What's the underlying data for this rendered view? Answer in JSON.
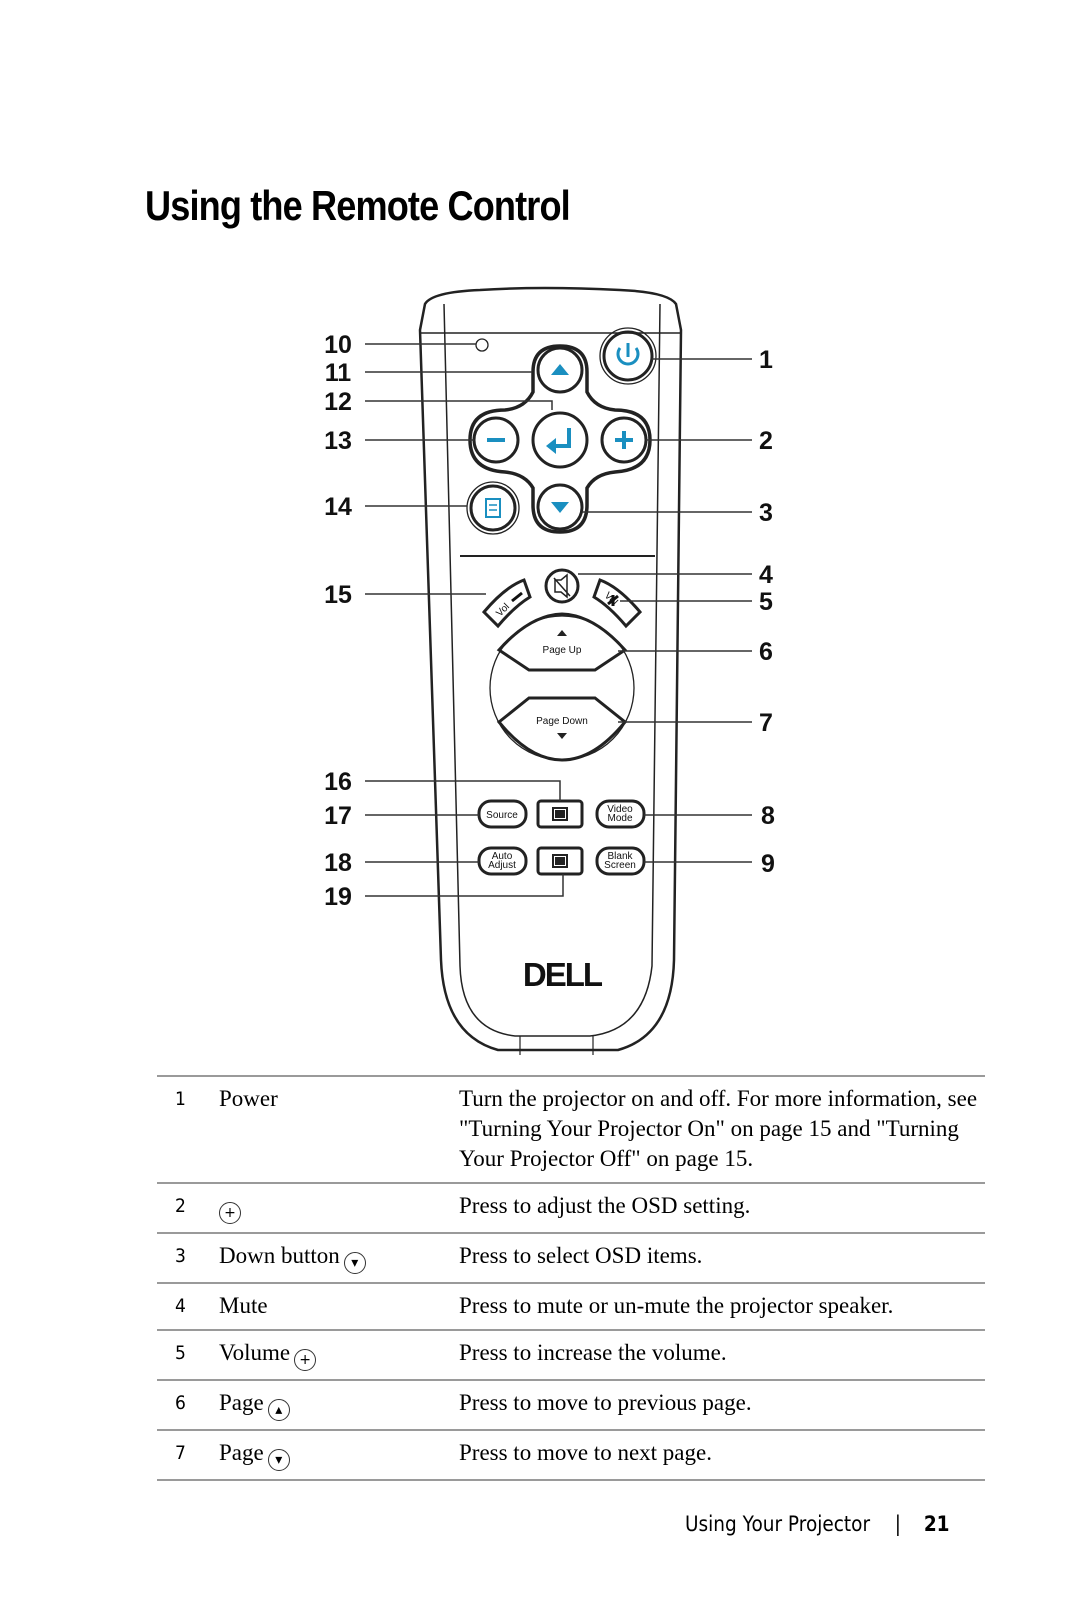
{
  "page": {
    "title": "Using the Remote Control",
    "footer": {
      "section": "Using Your Projector",
      "separator": "|",
      "page_number": "21"
    }
  },
  "remote": {
    "brand_logo": "DELL",
    "callouts": [
      "1",
      "2",
      "3",
      "4",
      "5",
      "6",
      "7",
      "8",
      "9",
      "10",
      "11",
      "12",
      "13",
      "14",
      "15",
      "16",
      "17",
      "18",
      "19"
    ],
    "buttons": {
      "vol_minus": "Vol",
      "vol_plus": "Vol",
      "page_up": "Page Up",
      "page_down": "Page Down",
      "source": "Source",
      "video_mode_line1": "Video",
      "video_mode_line2": "Mode",
      "auto_adjust_line1": "Auto",
      "auto_adjust_line2": "Adjust",
      "blank_screen_line1": "Blank",
      "blank_screen_line2": "Screen"
    },
    "accent_color": "#1a8fc0"
  },
  "legend": {
    "rows": [
      {
        "num": "1",
        "name": "Power",
        "icon": "",
        "desc": "Turn the projector on and off. For more information, see \"Turning Your Projector On\" on page 15 and \"Turning Your Projector Off\" on page 15."
      },
      {
        "num": "2",
        "name": "",
        "icon": "+",
        "desc": "Press to adjust the OSD setting."
      },
      {
        "num": "3",
        "name": "Down button",
        "icon": "▾",
        "desc": "Press to select OSD items."
      },
      {
        "num": "4",
        "name": "Mute",
        "icon": "",
        "desc": "Press to mute or un-mute the projector speaker."
      },
      {
        "num": "5",
        "name": "Volume",
        "icon": "+",
        "desc": "Press to increase the volume."
      },
      {
        "num": "6",
        "name": "Page",
        "icon": "▴",
        "desc": "Press to move to previous page."
      },
      {
        "num": "7",
        "name": "Page",
        "icon": "▾",
        "desc": "Press to move to next page."
      }
    ]
  }
}
